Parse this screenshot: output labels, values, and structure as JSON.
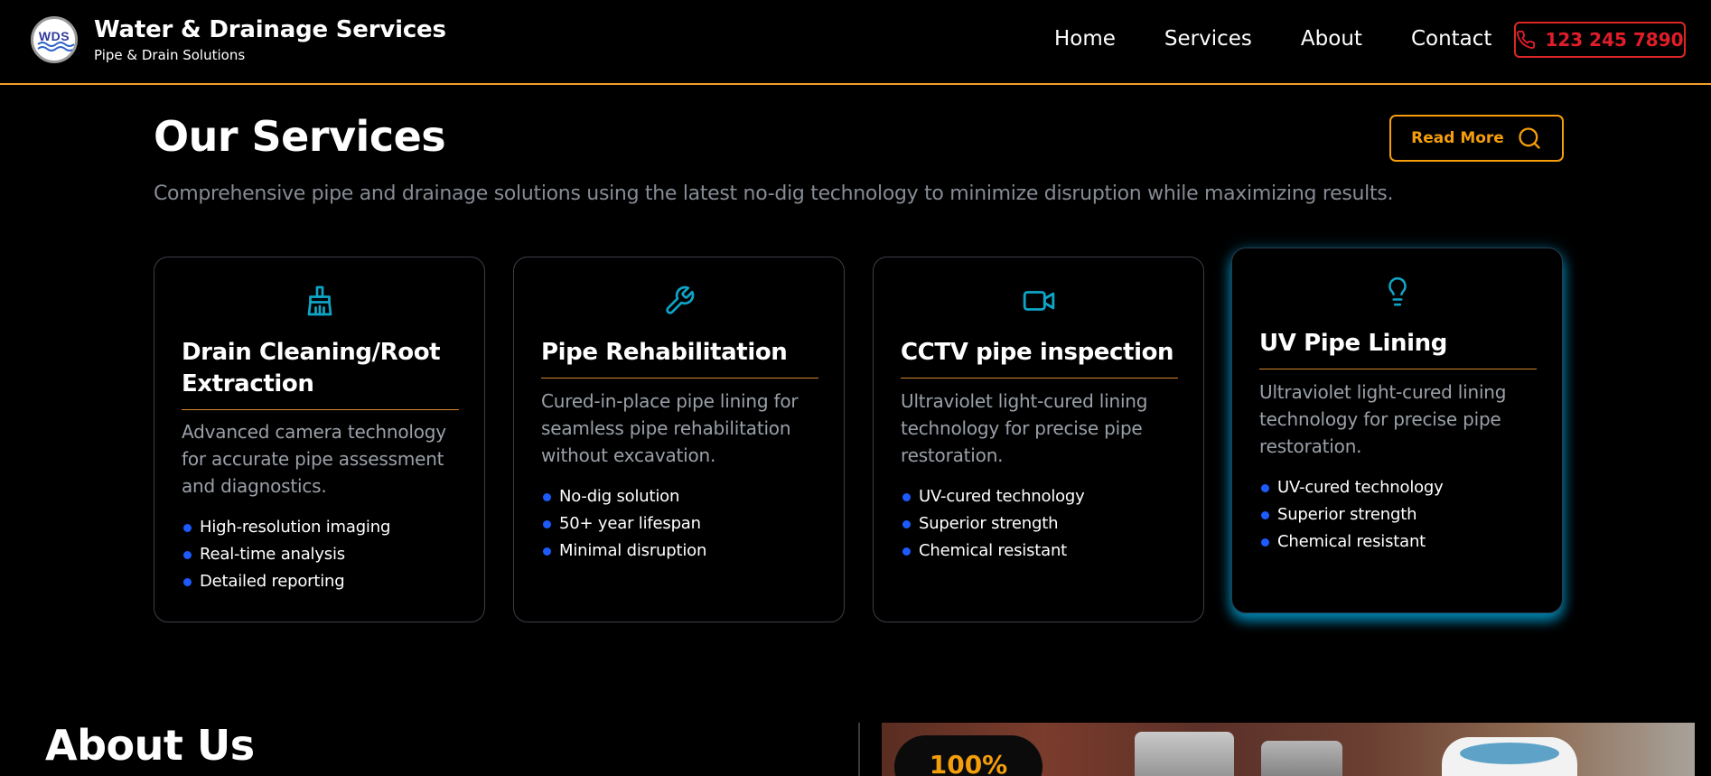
{
  "header": {
    "logo_text": "WDS",
    "brand_title": "Water & Drainage Services",
    "brand_subtitle": "Pipe & Drain Solutions",
    "nav": [
      "Home",
      "Services",
      "About",
      "Contact"
    ],
    "phone": "123 245 7890"
  },
  "services": {
    "title": "Our Services",
    "read_more": "Read More",
    "subtitle": "Comprehensive pipe and drainage solutions using the latest no-dig technology to minimize disruption while maximizing results.",
    "cards": [
      {
        "icon": "brush-icon",
        "title": "Drain Cleaning/Root Extraction",
        "description": "Advanced camera technology for accurate pipe assessment and diagnostics.",
        "features": [
          "High-resolution imaging",
          "Real-time analysis",
          "Detailed reporting"
        ]
      },
      {
        "icon": "wrench-icon",
        "title": "Pipe Rehabilitation",
        "description": "Cured-in-place pipe lining for seamless pipe rehabilitation without excavation.",
        "features": [
          "No-dig solution",
          "50+ year lifespan",
          "Minimal disruption"
        ]
      },
      {
        "icon": "video-camera-icon",
        "title": "CCTV pipe inspection",
        "description": "Ultraviolet light-cured lining technology for precise pipe restoration.",
        "features": [
          "UV-cured technology",
          "Superior strength",
          "Chemical resistant"
        ]
      },
      {
        "icon": "lightbulb-icon",
        "title": "UV Pipe Lining",
        "description": "Ultraviolet light-cured lining technology for precise pipe restoration.",
        "features": [
          "UV-cured technology",
          "Superior strength",
          "Chemical resistant"
        ]
      }
    ]
  },
  "about": {
    "title": "About Us",
    "badge": "100%"
  },
  "colors": {
    "accent_orange": "#f59e0b",
    "phone_red": "#e11d2a",
    "icon_blue": "#0ea5c6",
    "bullet_blue": "#1d5bff",
    "muted_text": "#868b94"
  }
}
